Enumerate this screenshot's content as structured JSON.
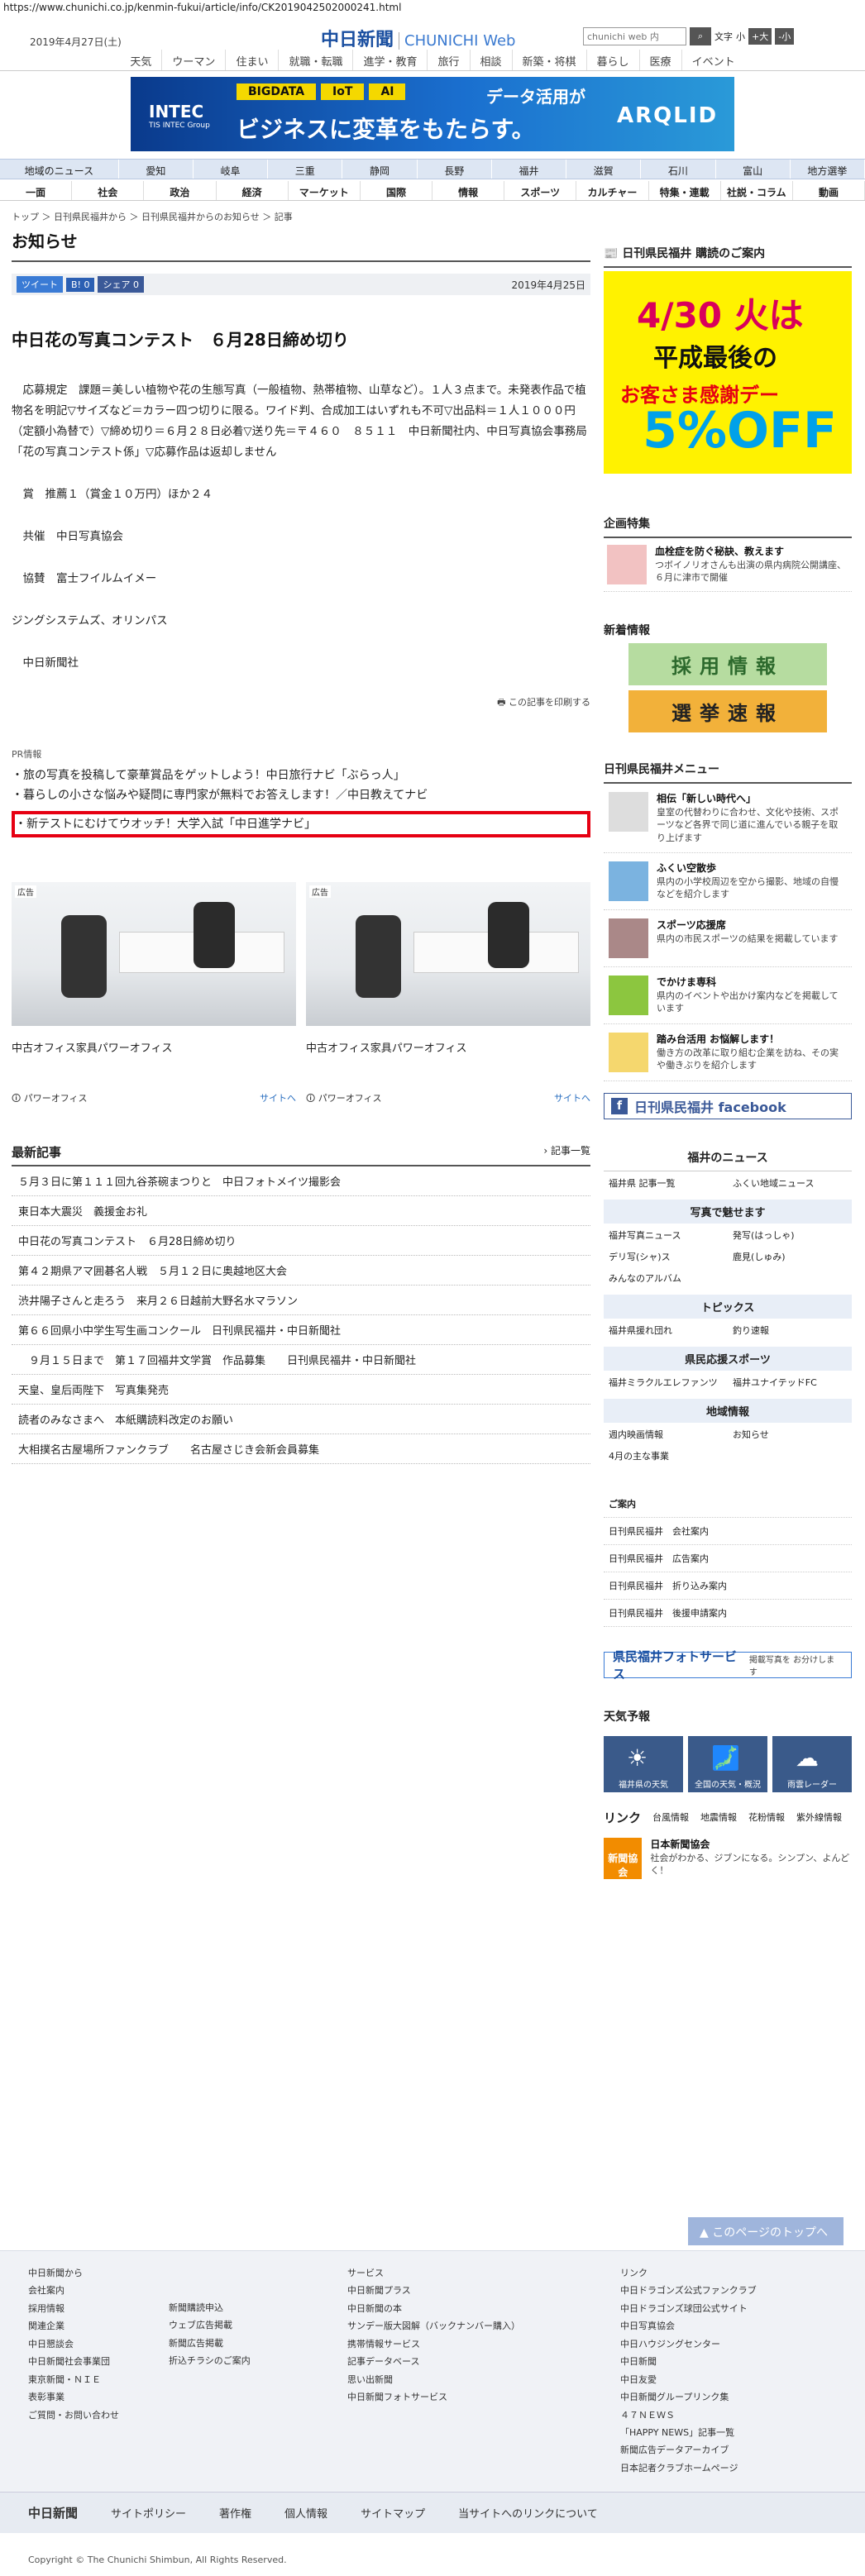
{
  "url": "https://www.chunichi.co.jp/kenmin-fukui/article/info/CK2019042502000241.html",
  "header": {
    "date": "2019年4月27日(土)",
    "logo": "中日新聞",
    "logo_en": "CHUNICHI Web",
    "search_placeholder": "chunichi web 内",
    "font_label": "文字",
    "font_small": "小",
    "font_large": "+大",
    "font_reduce": "-小"
  },
  "gnav": [
    "天気",
    "ウーマン",
    "住まい",
    "就職・転職",
    "進学・教育",
    "旅行",
    "相談",
    "新築・将棋",
    "暮らし",
    "医療",
    "イベント"
  ],
  "banner": {
    "tags": [
      "BIGDATA",
      "IoT",
      "AI"
    ],
    "line1": "データ活用が",
    "line2": "ビジネスに変革をもたらす。",
    "company": "INTEC",
    "company_sub": "TIS INTEC Group",
    "product": "ARQLID"
  },
  "nav1": [
    "地域のニュース",
    "愛知",
    "岐阜",
    "三重",
    "静岡",
    "長野",
    "福井",
    "滋賀",
    "石川",
    "富山",
    "地方選挙"
  ],
  "nav2": [
    "一面",
    "社会",
    "政治",
    "経済",
    "マーケット",
    "国際",
    "情報",
    "スポーツ",
    "カルチャー",
    "特集・連載",
    "社説・コラム",
    "動画"
  ],
  "breadcrumb": "トップ ＞ 日刊県民福井から ＞ 日刊県民福井からのお知らせ ＞ 記事",
  "page_title": "お知らせ",
  "social": {
    "tweet": "ツイート",
    "b": "B! 0",
    "share": "シェア 0",
    "date": "2019年4月25日"
  },
  "headline": "中日花の写真コンテスト　６月28日締め切り",
  "body": [
    "　応募規定　課題＝美しい植物や花の生態写真（一般植物、熱帯植物、山草など）。１人３点まで。未発表作品で植物名を明記▽サイズなど＝カラー四つ切りに限る。ワイド判、合成加工はいずれも不可▽出品料＝１人１０００円（定額小為替で）▽締め切り＝６月２８日必着▽送り先＝〒４６０　８５１１　中日新聞社内、中日写真協会事務局「花の写真コンテスト係」▽応募作品は返却しません",
    "　賞　推薦１（賞金１０万円）ほか２４",
    "　共催　中日写真協会",
    "　協賛　富士フイルムイメー",
    "ジングシステムズ、オリンパス",
    "　中日新聞社"
  ],
  "print_label": "この記事を印刷する",
  "pr": {
    "label": "PR情報",
    "items": [
      "旅の写真を投稿して豪華賞品をゲットしよう！中日旅行ナビ「ぶらっ人」",
      "暮らしの小さな悩みや疑問に専門家が無料でお答えします！／中日教えてナビ",
      "新テストにむけてウオッチ！大学入試「中日進学ナビ」"
    ]
  },
  "ads": [
    {
      "tag": "広告",
      "caption": "中古オフィス家具パワーオフィス",
      "brand": "パワーオフィス",
      "go": "サイトへ"
    },
    {
      "tag": "広告",
      "caption": "中古オフィス家具パワーオフィス",
      "brand": "パワーオフィス",
      "go": "サイトへ"
    }
  ],
  "latest": {
    "title": "最新記事",
    "all": "記事一覧",
    "items": [
      "５月３日に第１１１回九谷茶碗まつりと　中日フォトメイツ撮影会",
      "東日本大震災　義援金お礼",
      "中日花の写真コンテスト　６月28日締め切り",
      "第４２期県アマ囲碁名人戦　５月１２日に奥越地区大会",
      "渋井陽子さんと走ろう　来月２６日越前大野名水マラソン",
      "第６６回県小中学生写生画コンクール　日刊県民福井・中日新聞社",
      "　９月１５日まで　第１７回福井文学賞　作品募集　　日刊県民福井・中日新聞社",
      "天皇、皇后両陛下　写真集発売",
      "読者のみなさまへ　本紙購読料改定のお願い",
      "大相撲名古屋場所ファンクラブ　　名古屋さじき会新会員募集"
    ]
  },
  "side": {
    "subscribe": "日刊県民福井 購読のご案内",
    "coupon": {
      "date": "4/30 火は",
      "mid": "平成最後の",
      "s": "お客さま感謝デー",
      "pct": "5%OFF"
    },
    "feature_title": "企画特集",
    "feature": {
      "title": "血栓症を防ぐ秘訣、教えます",
      "text": "つボイノリオさんも出演の県内病院公開講座、６月に津市で開催"
    },
    "new_title": "新着情報",
    "recruit": "採用情報",
    "election": "選挙速報",
    "menu_title": "日刊県民福井メニュー",
    "menu": [
      {
        "title": "相伝「新しい時代へ」",
        "text": "皇室の代替わりに合わせ、文化や技術、スポーツなど各界で同じ道に進んでいる親子を取り上げます"
      },
      {
        "title": "ふくい空散歩",
        "text": "県内の小学校周辺を空から撮影、地域の自慢などを紹介します"
      },
      {
        "title": "スポーツ応援席",
        "text": "県内の市民スポーツの結果を掲載しています"
      },
      {
        "title": "でかけま専科",
        "text": "県内のイベントや出かけ案内などを掲載しています"
      },
      {
        "title": "踏み台活用 お悩解します！",
        "text": "働き方の改革に取り組む企業を訪ね、その実や働きぶりを紹介します"
      }
    ],
    "facebook": "日刊県民福井 facebook",
    "news_title": "福井のニュース",
    "news": [
      "福井県 記事一覧",
      "ふくい地域ニュース"
    ],
    "photo_title": "写真で魅せます",
    "photo": [
      "福井写真ニュース",
      "発写(はっしゃ)",
      "デリ写(シャ)ス",
      "鹿見(しゅみ)",
      "みんなのアルバム"
    ],
    "topics_title": "トピックス",
    "topics": [
      "福井県援れ団れ",
      "釣り速報"
    ],
    "sports_title": "県民応援スポーツ",
    "sports": [
      "福井ミラクルエレファンツ",
      "福井ユナイテッドFC"
    ],
    "region_title": "地域情報",
    "region": [
      "週内映画情報",
      "お知らせ",
      "4月の主な事業"
    ],
    "gaiyo_title": "ご案内",
    "gaiyo": [
      "日刊県民福井　会社案内",
      "日刊県民福井　広告案内",
      "日刊県民福井　折り込み案内",
      "日刊県民福井　後援申請案内"
    ],
    "photo_service": "県民福井フォトサービス",
    "photo_service_note": "掲載写真を お分けします",
    "weather_title": "天気予報",
    "weather": [
      "福井県の天気",
      "全国の天気・概況",
      "雨雲レーダー"
    ],
    "link_title": "リンク",
    "links": [
      "台風情報",
      "地震情報",
      "花粉情報",
      "紫外線情報"
    ],
    "nsk_logo": "新聞協会",
    "nsk_name": "日本新聞協会",
    "nsk_text": "社会がわかる、ジブンになる。シンプン、よんどく！"
  },
  "totop": "このページのトップへ",
  "footer": {
    "col1_title": "中日新聞から",
    "col1": [
      "会社案内",
      "採用情報",
      "関連企業",
      "中日懇談会",
      "中日新聞社会事業団",
      "東京新聞・ＮＩＥ",
      "表彰事業",
      "ご質問・お問い合わせ"
    ],
    "col2": [
      "新聞購読申込",
      "ウェブ広告掲載",
      "新聞広告掲載",
      "折込チラシのご案内"
    ],
    "col3_title": "サービス",
    "col3": [
      "中日新聞プラス",
      "中日新聞の本",
      "サンデー版大図解（バックナンバー購入）",
      "携帯情報サービス",
      "記事データベース",
      "思い出新聞",
      "中日新聞フォトサービス"
    ],
    "col4_title": "リンク",
    "col4": [
      "中日ドラゴンズ公式ファンクラブ",
      "中日ドラゴンズ球団公式サイト",
      "中日写真協会",
      "中日ハウジングセンター",
      "中日新聞",
      "中日友愛",
      "中日新聞グループリンク集",
      "４７ＮＥＷＳ",
      "「HAPPY NEWS」記事一覧",
      "新聞広告データアーカイブ",
      "日本記者クラブホームページ"
    ],
    "bar": [
      "中日新聞",
      "サイトポリシー",
      "著作権",
      "個人情報",
      "サイトマップ",
      "当サイトへのリンクについて"
    ],
    "copyright": "Copyright © The Chunichi Shimbun, All Rights Reserved."
  },
  "colors": {
    "brand": "#1a4fa0",
    "highlight": "#e60012"
  }
}
